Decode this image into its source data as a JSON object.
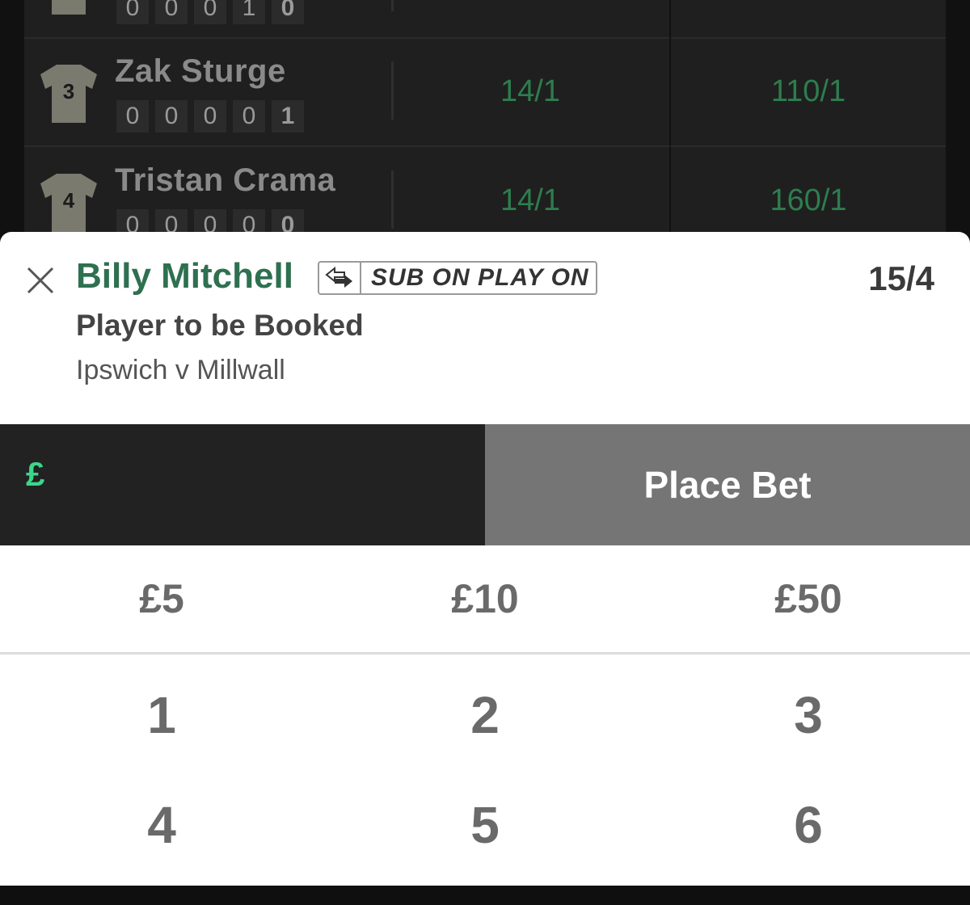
{
  "players": [
    {
      "shirt_number": "",
      "name": "",
      "stats": [
        "0",
        "0",
        "0",
        "1",
        "0"
      ],
      "odds": [
        "",
        ""
      ]
    },
    {
      "shirt_number": "3",
      "name": "Zak Sturge",
      "stats": [
        "0",
        "0",
        "0",
        "0",
        "1"
      ],
      "odds": [
        "14/1",
        "110/1"
      ]
    },
    {
      "shirt_number": "4",
      "name": "Tristan Crama",
      "stats": [
        "0",
        "0",
        "0",
        "0",
        "0"
      ],
      "odds": [
        "14/1",
        "160/1"
      ]
    }
  ],
  "betslip": {
    "selection": "Billy Mitchell",
    "badge": "SUB ON PLAY ON",
    "price": "15/4",
    "market": "Player to be Booked",
    "event": "Ipswich v Millwall"
  },
  "stake": {
    "currency": "£",
    "value": ""
  },
  "place_bet_label": "Place Bet",
  "quick_stakes": [
    "£5",
    "£10",
    "£50"
  ],
  "keypad": [
    "1",
    "2",
    "3",
    "4",
    "5",
    "6"
  ],
  "colors": {
    "brand_green": "#2e7050",
    "odds_green": "#2e7d4f",
    "currency_green": "#3bd68a",
    "place_bet_bg": "#757575"
  }
}
